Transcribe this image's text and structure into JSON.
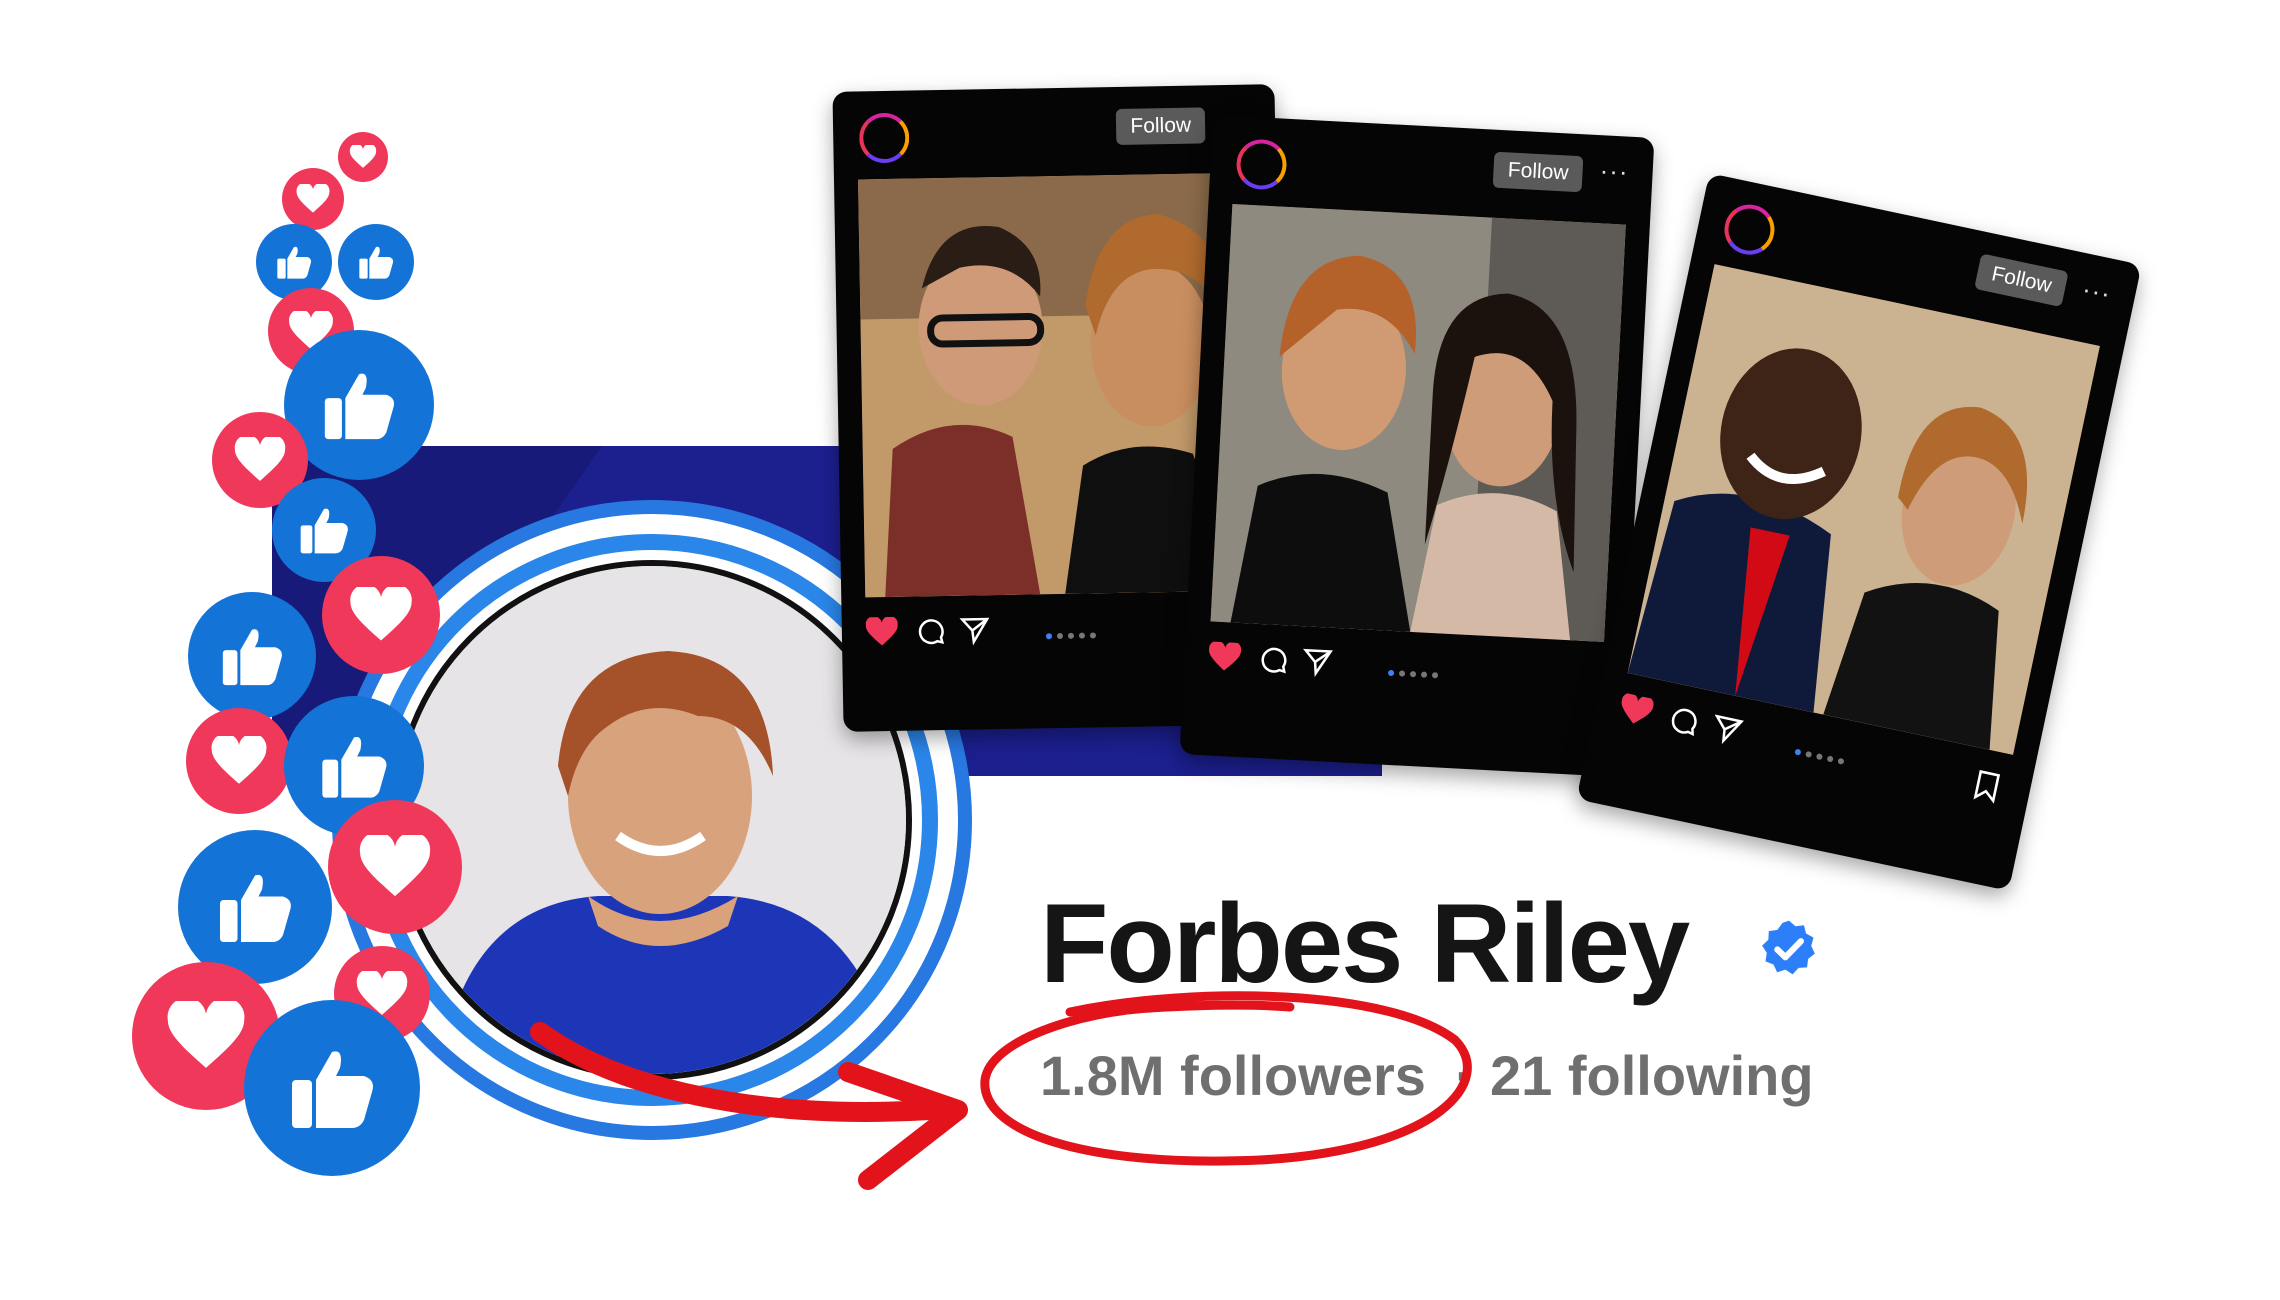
{
  "profile": {
    "name": "Forbes Riley",
    "followers": "1.8M followers",
    "separator": "·",
    "following": "21 following",
    "verified": true
  },
  "cards": [
    {
      "follow_label": "Follow",
      "more": "···"
    },
    {
      "follow_label": "Follow",
      "more": "···"
    },
    {
      "follow_label": "Follow",
      "more": "···"
    }
  ],
  "icons": [
    "like-icon",
    "love-icon",
    "heart-icon",
    "comment-icon",
    "send-icon",
    "bookmark-icon",
    "verified-badge-icon"
  ],
  "colors": {
    "like": "#1473d6",
    "love": "#f0385a",
    "annotation_red": "#e3131b",
    "cover": "#1c1f8e",
    "ring": "#2778e0",
    "verified": "#2d7ff9"
  }
}
